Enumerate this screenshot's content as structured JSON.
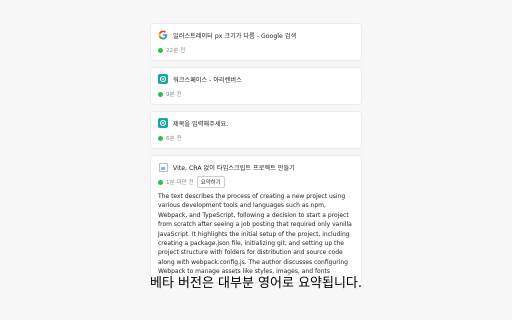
{
  "items": [
    {
      "title": "일러스트레이터 px 크기가 다름 - Google 검색",
      "time": "22분 전",
      "favicon": "google-icon"
    },
    {
      "title": "워크스페이스 - 아리렌버스",
      "time": "9분 전",
      "favicon": "workspace-icon"
    },
    {
      "title": "제목을 입력해주세요.",
      "time": "6분 전",
      "favicon": "workspace-icon"
    },
    {
      "title": "Vite, CRA 없이 타입스크립트 프로젝트 만들기",
      "time": "1분 미만 전",
      "favicon": "broken-image-icon",
      "summarize_label": "요약하기",
      "summary": "The text describes the process of creating a new project using various development tools and languages such as npm, Webpack, and TypeScript, following a decision to start a project from scratch after seeing a job posting that required only vanilla JavaScript. It highlights the initial setup of the project, including creating a package.json file, initializing git, and setting up the project structure with folders for distribution and source code along with webpack.config.js. The author discusses configuring Webpack to manage assets like styles, images, and fonts"
    }
  ],
  "caption": "베타 버전은 대부분 영어로 요약됩니다.",
  "colors": {
    "status_dot": "#2ec04a",
    "workspace_icon": "#1aa6a0"
  }
}
